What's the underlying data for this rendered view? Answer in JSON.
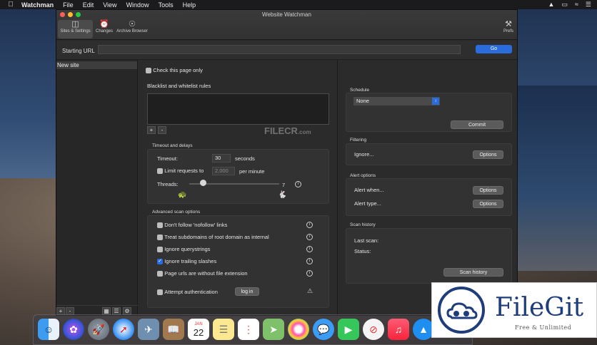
{
  "menubar": {
    "app": "Watchman",
    "items": [
      "File",
      "Edit",
      "View",
      "Window",
      "Tools",
      "Help"
    ]
  },
  "window": {
    "title": "Website Watchman",
    "toolbar": {
      "sites_settings": "Sites & Settings",
      "changes": "Changes",
      "archive_browser": "Archive Browser",
      "prefs": "Prefs"
    }
  },
  "url": {
    "label": "Starting URL",
    "value": "",
    "go": "Go"
  },
  "sidebar": {
    "items": [
      {
        "label": "New site"
      }
    ],
    "add": "+",
    "remove": "-"
  },
  "center": {
    "check_page_only": "Check this page only",
    "rules_title": "Blacklist and whitelist rules",
    "rules_add": "+",
    "rules_remove": "-",
    "timeout_group": "Timeout and delays",
    "timeout_label": "Timeout:",
    "timeout_value": "30",
    "timeout_unit": "seconds",
    "limit_label": "Limit requests to",
    "limit_value": "2,000",
    "limit_unit": "per minute",
    "threads_label": "Threads:",
    "threads_value": "7",
    "threads_level": 0.15,
    "advanced_group": "Advanced scan options",
    "options": [
      {
        "label": "Don't follow 'nofollow' links",
        "checked": false
      },
      {
        "label": "Treat subdomains of root domain as internal",
        "checked": false
      },
      {
        "label": "Ignore querystrings",
        "checked": false
      },
      {
        "label": "Ignore trailing slashes",
        "checked": true
      },
      {
        "label": "Page urls are without file extension",
        "checked": false
      }
    ],
    "auth_label": "Attempt authentication",
    "login_button": "log in"
  },
  "right": {
    "schedule": {
      "title": "Schedule",
      "select": "None",
      "commit": "Commit"
    },
    "filtering": {
      "title": "Filtering",
      "label": "Ignore...",
      "button": "Options"
    },
    "alerts": {
      "title": "Alert options",
      "when_label": "Alert when...",
      "when_button": "Options",
      "type_label": "Alert type...",
      "type_button": "Options"
    },
    "history": {
      "title": "Scan history",
      "last_scan": "Last scan:",
      "status": "Status:",
      "button": "Scan history"
    }
  },
  "calendar": {
    "month": "JAN",
    "day": "22"
  },
  "watermark": {
    "brand": "FileGit",
    "tagline": "Free & Unlimited",
    "overlay": "FILECR",
    "overlay_sub": ".com"
  },
  "colors": {
    "accent": "#2a6cdc",
    "window_bg": "#2b2b2b",
    "brand": "#1f3d7a"
  }
}
